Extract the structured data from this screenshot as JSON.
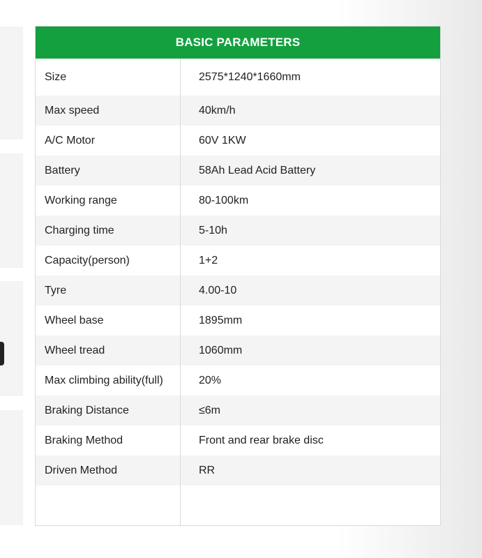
{
  "table": {
    "title": "BASIC PARAMETERS",
    "rows": [
      {
        "name": "Size",
        "value": "2575*1240*1660mm"
      },
      {
        "name": "Max speed",
        "value": "40km/h"
      },
      {
        "name": "A/C Motor",
        "value": "60V 1KW"
      },
      {
        "name": "Battery",
        "value": "58Ah Lead Acid Battery"
      },
      {
        "name": "Working range",
        "value": "80-100km"
      },
      {
        "name": "Charging time",
        "value": "5-10h"
      },
      {
        "name": "Capacity(person)",
        "value": "1+2"
      },
      {
        "name": "Tyre",
        "value": "4.00-10"
      },
      {
        "name": "Wheel base",
        "value": "1895mm"
      },
      {
        "name": "Wheel tread",
        "value": "1060mm"
      },
      {
        "name": "Max climbing ability(full)",
        "value": "20%"
      },
      {
        "name": "Braking Distance",
        "value": "≤6m"
      },
      {
        "name": "Braking Method",
        "value": "Front and rear brake disc"
      },
      {
        "name": "Driven Method",
        "value": "RR"
      }
    ]
  },
  "colors": {
    "header_green": "#14a03f",
    "row_stripe": "#f4f4f4",
    "border": "#d9d9d9"
  }
}
